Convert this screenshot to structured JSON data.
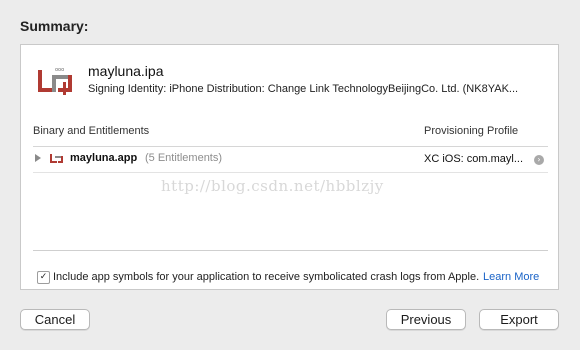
{
  "summary": {
    "title": "Summary:"
  },
  "app": {
    "name": "mayluna.ipa",
    "signing_identity": "Signing Identity: iPhone Distribution: Change Link TechnologyBeijingCo. Ltd. (NK8YAK..."
  },
  "table": {
    "col_binary": "Binary and Entitlements",
    "col_profile": "Provisioning Profile",
    "rows": [
      {
        "app": "mayluna.app",
        "entitlements": "(5 Entitlements)",
        "profile": "XC iOS: com.mayl..."
      }
    ]
  },
  "watermark": "http://blog.csdn.net/hbblzjy",
  "options": {
    "checkbox_checked": true,
    "checkbox_label": "Include app symbols for your application to receive symbolicated crash logs from Apple.",
    "learn_more": "Learn More"
  },
  "buttons": {
    "cancel": "Cancel",
    "previous": "Previous",
    "export": "Export"
  },
  "colors": {
    "icon_red": "#b03a32",
    "link": "#1a63c7"
  }
}
